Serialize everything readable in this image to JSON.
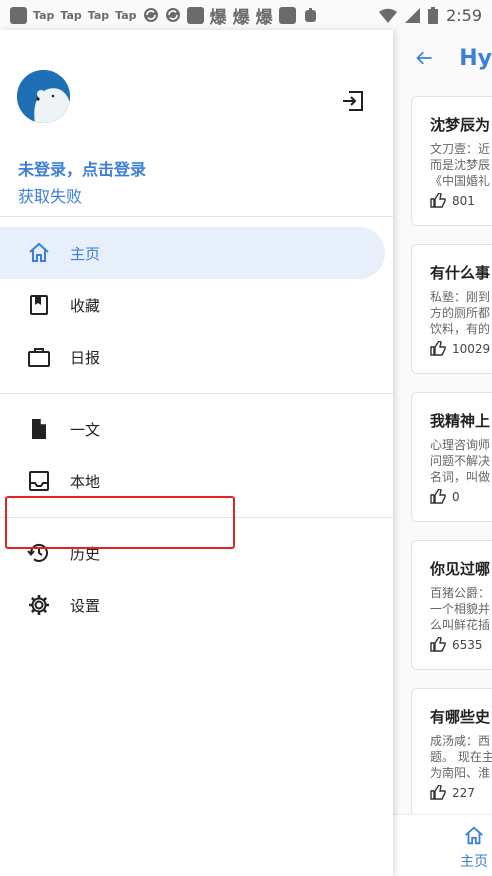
{
  "status_bar": {
    "left_items": [
      "Tap",
      "Tap",
      "Tap",
      "Tap",
      "爆",
      "爆",
      "爆"
    ],
    "time": "2:59"
  },
  "background": {
    "title": "Hy",
    "cards": [
      {
        "title": "沈梦辰为",
        "lines": [
          "文刀壹：近",
          "而是沈梦辰",
          "《中国婚礼"
        ],
        "likes": "801"
      },
      {
        "title": "有什么事",
        "lines": [
          "私塾：刚到",
          "方的厕所都",
          "饮料，有的"
        ],
        "likes": "10029"
      },
      {
        "title": "我精神上",
        "lines": [
          "心理咨询师",
          "问题不解决",
          "名词，叫做"
        ],
        "likes": "0"
      },
      {
        "title": "你见过哪",
        "lines": [
          "百猪公爵：",
          "一个相貌并",
          "么叫鲜花插"
        ],
        "likes": "6535"
      },
      {
        "title": "有哪些史",
        "lines": [
          "成汤咸：西",
          "题。 现在主",
          "为南阳、淮"
        ],
        "likes": "227"
      }
    ],
    "bottom_nav_label": "主页"
  },
  "drawer": {
    "login_prompt": "未登录，点击登录",
    "status": "获取失败",
    "nav_groups": [
      [
        {
          "label": "主页",
          "icon": "home-icon",
          "active": true
        },
        {
          "label": "收藏",
          "icon": "bookmark-icon",
          "active": false
        },
        {
          "label": "日报",
          "icon": "briefcase-icon",
          "active": false
        }
      ],
      [
        {
          "label": "一文",
          "icon": "document-icon",
          "active": false
        },
        {
          "label": "本地",
          "icon": "inbox-icon",
          "active": false
        }
      ],
      [
        {
          "label": "历史",
          "icon": "history-icon",
          "active": false
        },
        {
          "label": "设置",
          "icon": "gear-icon",
          "active": false
        }
      ]
    ]
  },
  "colors": {
    "accent": "#3b7fd6",
    "highlight": "#e02424"
  }
}
